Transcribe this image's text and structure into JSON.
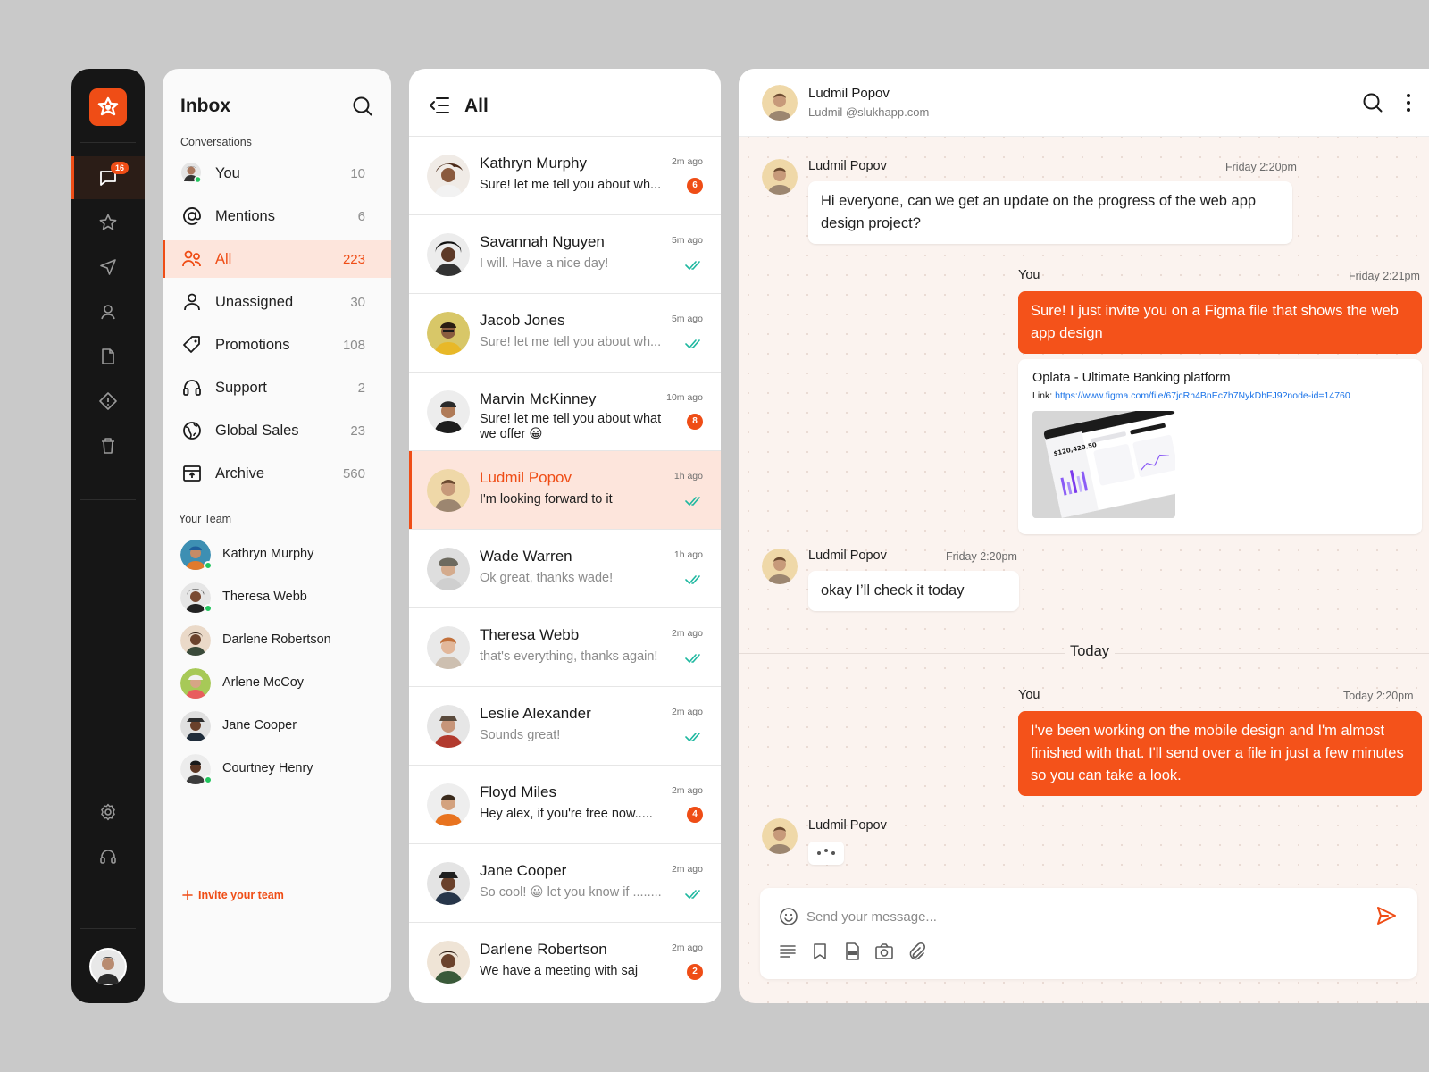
{
  "rail": {
    "notification_count": "16",
    "items": [
      "chat-icon",
      "star-icon",
      "send-icon",
      "user-icon",
      "document-icon",
      "alert-icon",
      "trash-icon",
      "gear-icon",
      "headset-icon"
    ],
    "accent": "#ef4d16"
  },
  "inbox": {
    "title": "Inbox",
    "conversations_heading": "Conversations",
    "items": [
      {
        "label": "You",
        "count": "10"
      },
      {
        "label": "Mentions",
        "count": "6"
      },
      {
        "label": "All",
        "count": "223"
      },
      {
        "label": "Unassigned",
        "count": "30"
      },
      {
        "label": "Promotions",
        "count": "108"
      },
      {
        "label": "Support",
        "count": "2"
      },
      {
        "label": "Global Sales",
        "count": "23"
      },
      {
        "label": "Archive",
        "count": "560"
      }
    ],
    "team_heading": "Your Team",
    "team": [
      {
        "name": "Kathryn Murphy",
        "online": true
      },
      {
        "name": "Theresa Webb",
        "online": true
      },
      {
        "name": "Darlene Robertson",
        "online": false
      },
      {
        "name": "Arlene McCoy",
        "online": false
      },
      {
        "name": "Jane Cooper",
        "online": false
      },
      {
        "name": "Courtney Henry",
        "online": true
      }
    ],
    "invite_label": "Invite your team"
  },
  "list": {
    "title": "All",
    "conversations": [
      {
        "name": "Kathryn Murphy",
        "time": "2m ago",
        "message": "Sure! let me tell you about wh...",
        "unread": "6",
        "read": false
      },
      {
        "name": "Savannah Nguyen",
        "time": "5m ago",
        "message": "I will. Have a nice day!",
        "unread": "",
        "read": true
      },
      {
        "name": "Jacob Jones",
        "time": "5m ago",
        "message": "Sure! let me tell you about wh...",
        "unread": "",
        "read": true
      },
      {
        "name": "Marvin McKinney",
        "time": "10m ago",
        "message": "Sure! let me tell you about what we offer 😀",
        "unread": "8",
        "read": false
      },
      {
        "name": "Ludmil Popov",
        "time": "1h ago",
        "message": "I'm looking forward to it",
        "unread": "",
        "read": false
      },
      {
        "name": "Wade Warren",
        "time": "1h ago",
        "message": "Ok great, thanks wade!",
        "unread": "",
        "read": true
      },
      {
        "name": "Theresa Webb",
        "time": "2m ago",
        "message": "that's everything, thanks again!",
        "unread": "",
        "read": true
      },
      {
        "name": "Leslie Alexander",
        "time": "2m ago",
        "message": "Sounds great!",
        "unread": "",
        "read": true
      },
      {
        "name": "Floyd Miles",
        "time": "2m ago",
        "message": "Hey alex, if you're free now.....",
        "unread": "4",
        "read": false
      },
      {
        "name": "Jane Cooper",
        "time": "2m ago",
        "message": "So cool! 😀 let you know if ........",
        "unread": "",
        "read": true
      },
      {
        "name": "Darlene Robertson",
        "time": "2m ago",
        "message": "We have a meeting with saj",
        "unread": "2",
        "read": false
      }
    ]
  },
  "chat": {
    "contact_name": "Ludmil Popov",
    "contact_email": "Ludmil @slukhapp.com",
    "messages": [
      {
        "sender": "Ludmil Popov",
        "time": "Friday 2:20pm",
        "text": "Hi everyone, can we get an update on the progress of the web app design project?"
      },
      {
        "sender": "You",
        "time": "Friday 2:21pm",
        "text": "Sure! I just invite you on a Figma file that shows the web app design"
      },
      {
        "sender": "Ludmil Popov",
        "time": "Friday 2:20pm",
        "text": "okay I’ll check it today"
      },
      {
        "sender": "You",
        "time": "Today 2:20pm",
        "text": "I've been working on the mobile design and I'm almost finished with that. I'll send over a file in just a few minutes so you can take a look."
      },
      {
        "sender": "Ludmil Popov",
        "time": "",
        "text": ""
      }
    ],
    "link_card": {
      "title": "Oplata - Ultimate Banking platform",
      "link_label": "Link:",
      "url": "https://www.figma.com/file/67jcRh4BnEc7h7NykDhFJ9?node-id=14760",
      "thumb_amount": "$120,420.50"
    },
    "divider_label": "Today",
    "composer": {
      "placeholder": "Send your message..."
    }
  }
}
